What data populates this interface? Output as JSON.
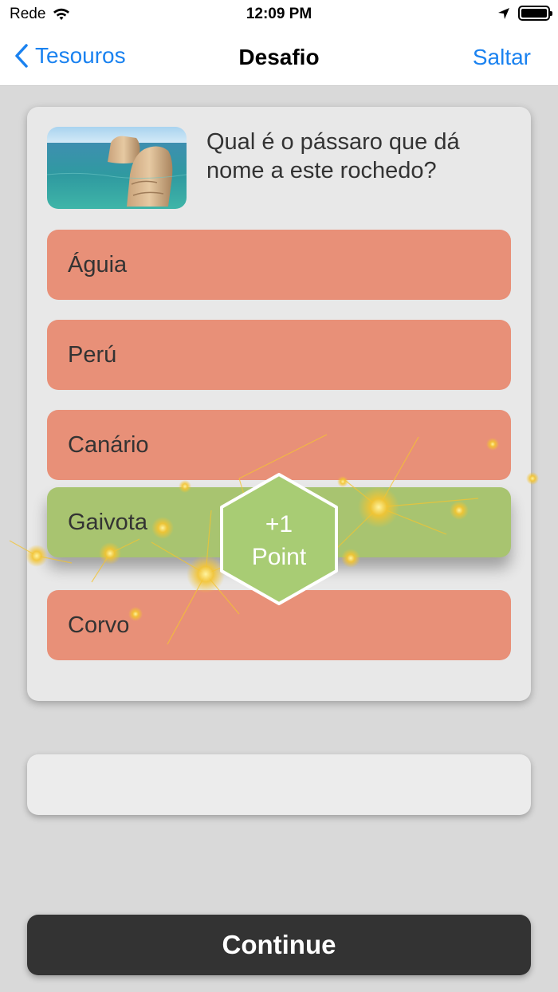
{
  "status_bar": {
    "carrier": "Rede",
    "time": "12:09 PM"
  },
  "nav": {
    "back_label": "Tesouros",
    "title": "Desafio",
    "right_label": "Saltar"
  },
  "question": {
    "text": "Qual é o pássaro que dá nome a este rochedo?"
  },
  "options": [
    {
      "label": "Águia",
      "state": "incorrect"
    },
    {
      "label": "Perú",
      "state": "incorrect"
    },
    {
      "label": "Canário",
      "state": "incorrect"
    },
    {
      "label": "Gaivota",
      "state": "correct"
    },
    {
      "label": "Corvo",
      "state": "incorrect"
    }
  ],
  "reward": {
    "amount": "+1",
    "unit": "Point"
  },
  "continue_label": "Continue",
  "colors": {
    "accent": "#1a82f0",
    "incorrect_option": "#e89078",
    "correct_option": "#a8c470",
    "continue_button": "#333333",
    "sparkle": "#f4c430"
  }
}
